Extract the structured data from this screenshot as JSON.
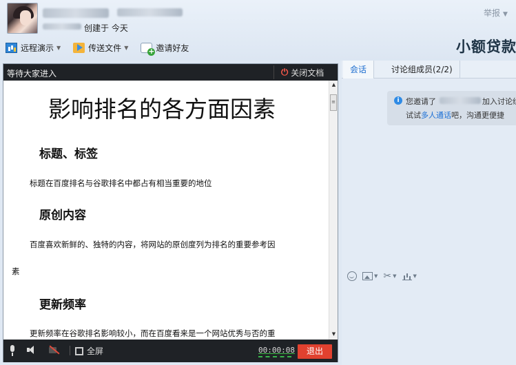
{
  "header": {
    "created_text": "创建于 今天",
    "report_label": "举报",
    "brand_text": "小额贷款"
  },
  "toolbar": {
    "remote_label": "远程演示",
    "send_label": "传送文件",
    "invite_label": "邀请好友"
  },
  "doc_panel": {
    "waiting_text": "等待大家进入",
    "close_label": "关闭文档",
    "title": "影响排名的各方面因素",
    "sections": [
      {
        "heading": "标题、标签",
        "para": "标题在百度排名与谷歌排名中都占有相当重要的地位"
      },
      {
        "heading": "原创内容",
        "para": "百度喜欢新鲜的、独特的内容，将网站的原创度列为排名的重要参考因",
        "para_cont": "素"
      },
      {
        "heading": "更新频率",
        "para": "更新频率在谷歌排名影响较小，而在百度看来是一个网站优秀与否的重"
      }
    ],
    "bottom": {
      "fullscreen_label": "全屏",
      "timer": "00:00:08",
      "exit_label": "退出"
    }
  },
  "chat_panel": {
    "tabs": [
      "会话",
      "讨论组成员(2/2)"
    ],
    "notice": {
      "line1_prefix": "您邀请了",
      "line1_suffix": "加入讨论组",
      "line2_prefix": "试试",
      "line2_link": "多人通话",
      "line2_suffix": "吧，沟通更便捷"
    }
  },
  "colors": {
    "accent_blue": "#1f6fd0",
    "exit_red": "#e1412f",
    "dark_bar": "#1f2226",
    "timer_green": "#39b54a"
  }
}
